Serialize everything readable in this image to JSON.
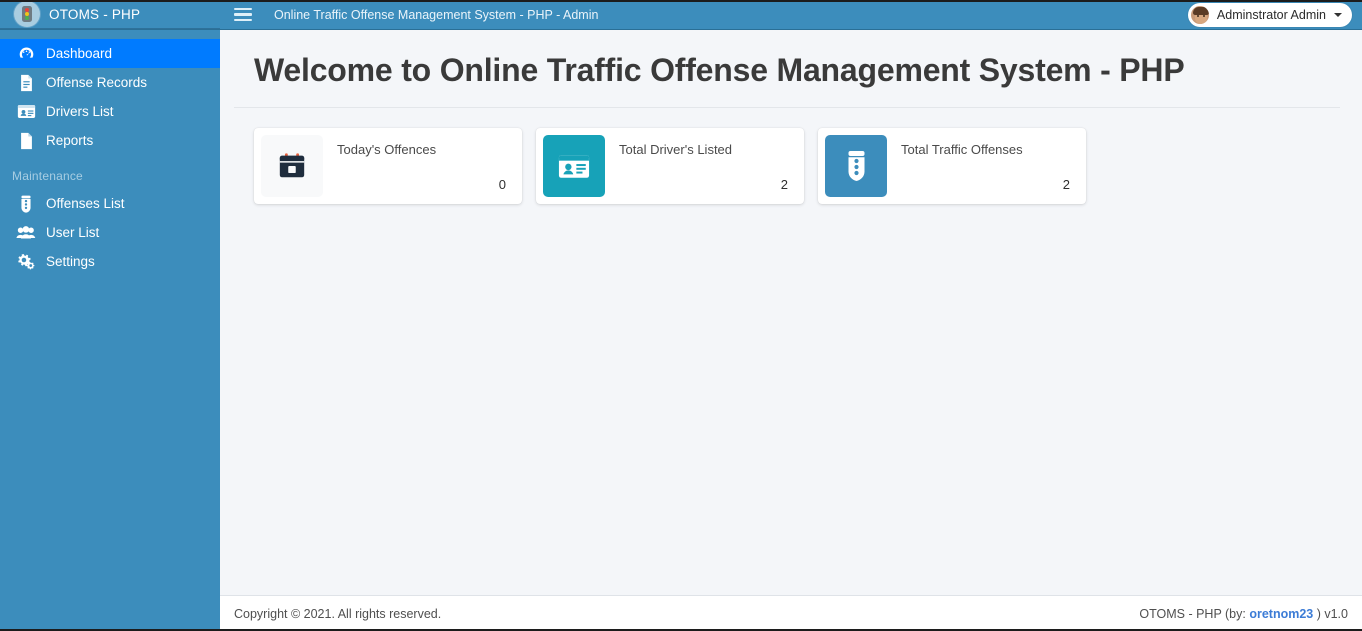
{
  "brand": {
    "title": "OTOMS - PHP",
    "logo_icon": "traffic-light-icon"
  },
  "topbar": {
    "menu_icon": "hamburger-menu-icon",
    "title": "Online Traffic Offense Management System - PHP - Admin",
    "user": {
      "name": "Adminstrator Admin",
      "avatar_icon": "user-avatar",
      "caret_icon": "chevron-down-icon"
    },
    "colors": {
      "background": "#3c8dbc"
    }
  },
  "sidebar": {
    "colors": {
      "background": "#3c8dbc",
      "active": "#007bff"
    },
    "items": [
      {
        "label": "Dashboard",
        "icon": "tachometer-icon",
        "active": true
      },
      {
        "label": "Offense Records",
        "icon": "file-lines-icon",
        "active": false
      },
      {
        "label": "Drivers List",
        "icon": "id-card-icon",
        "active": false
      },
      {
        "label": "Reports",
        "icon": "file-icon",
        "active": false
      }
    ],
    "section_header": "Maintenance",
    "maintenance_items": [
      {
        "label": "Offenses List",
        "icon": "traffic-light-icon",
        "active": false
      },
      {
        "label": "User List",
        "icon": "users-icon",
        "active": false
      },
      {
        "label": "Settings",
        "icon": "cogs-icon",
        "active": false
      }
    ]
  },
  "main": {
    "page_title": "Welcome to Online Traffic Offense Management System - PHP",
    "cards": [
      {
        "label": "Today's Offences",
        "value": "0",
        "icon": "calendar-icon",
        "icon_style": "light",
        "icon_color": "#f8f9fa"
      },
      {
        "label": "Total Driver's Listed",
        "value": "2",
        "icon": "id-card-icon",
        "icon_style": "teal",
        "icon_color": "#17a2b8"
      },
      {
        "label": "Total Traffic Offenses",
        "value": "2",
        "icon": "traffic-light-icon",
        "icon_style": "blue",
        "icon_color": "#3c8dbc"
      }
    ]
  },
  "footer": {
    "copyright": "Copyright © 2021. All rights reserved.",
    "right_prefix": "OTOMS - PHP (by: ",
    "right_link": "oretnom23",
    "right_suffix": " ) v1.0"
  }
}
